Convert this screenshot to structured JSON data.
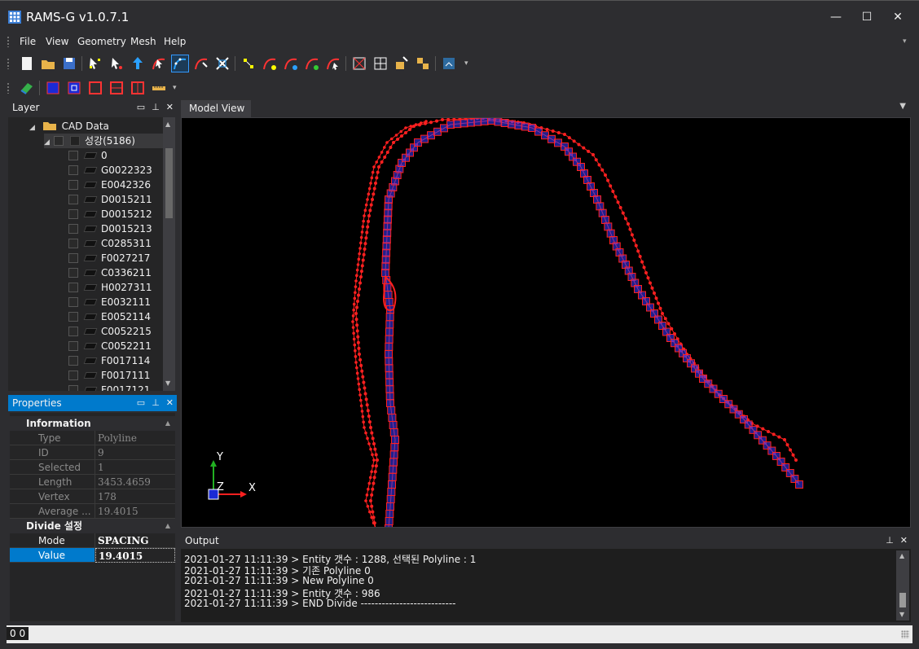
{
  "window": {
    "title": "RAMS-G v1.0.7.1",
    "minimize": "—",
    "maximize": "☐",
    "close": "✕"
  },
  "menu": [
    "File",
    "View",
    "Geometry",
    "Mesh",
    "Help"
  ],
  "toolbar1": [
    "new-file",
    "open-folder",
    "save",
    "select-points",
    "select-lines",
    "pick-up",
    "pick-curve",
    "divide-curve",
    "divide-spacing",
    "trim",
    "node-add",
    "curve-add",
    "curve-edit",
    "curve-move",
    "curve-delete",
    "mesh-grid-a",
    "mesh-grid-b",
    "mesh-refine-a",
    "mesh-refine-b",
    "export"
  ],
  "toolbar2": [
    "map-layer",
    "box-a",
    "box-b",
    "box-c",
    "box-d",
    "box-e",
    "ruler"
  ],
  "layer_panel": {
    "title": "Layer",
    "root": "CAD Data",
    "group": "성강(5186)",
    "layers": [
      "0",
      "G0022323",
      "E0042326",
      "D0015211",
      "D0015212",
      "D0015213",
      "C0285311",
      "F0027217",
      "C0336211",
      "H0027311",
      "E0032111",
      "E0052114",
      "C0052215",
      "C0052211",
      "F0017114",
      "F0017111",
      "F0017121"
    ]
  },
  "properties_panel": {
    "title": "Properties",
    "information": {
      "label": "Information",
      "rows": [
        {
          "key": "Type",
          "value": "Polyline"
        },
        {
          "key": "ID",
          "value": "9"
        },
        {
          "key": "Selected",
          "value": "1"
        },
        {
          "key": "Length",
          "value": "3453.4659"
        },
        {
          "key": "Vertex",
          "value": "178"
        },
        {
          "key": "Average ...",
          "value": "19.4015"
        }
      ]
    },
    "divide": {
      "label": "Divide 설정",
      "rows": [
        {
          "key": "Mode",
          "value": "SPACING"
        },
        {
          "key": "Value",
          "value": "19.4015"
        }
      ]
    }
  },
  "model_view": {
    "tab": "Model View",
    "axis_y": "Y",
    "axis_z": "Z",
    "axis_x": "X",
    "colors": {
      "curve": "#ff2020",
      "node_fill": "#3a3aff"
    }
  },
  "output_panel": {
    "title": "Output",
    "lines": [
      "2021-01-27 11:11:39 > Entity 갯수 : 1288, 선택된 Polyline : 1",
      "2021-01-27 11:11:39 > 기존 Polyline 0",
      "2021-01-27 11:11:39 > New Polyline 0",
      "2021-01-27 11:11:39 > Entity 갯수 : 986",
      "2021-01-27 11:11:39 > END Divide ---------------------------"
    ]
  },
  "status": {
    "coords": "0 0"
  },
  "colors": {
    "accent": "#007acc",
    "background": "#2d2d30"
  }
}
